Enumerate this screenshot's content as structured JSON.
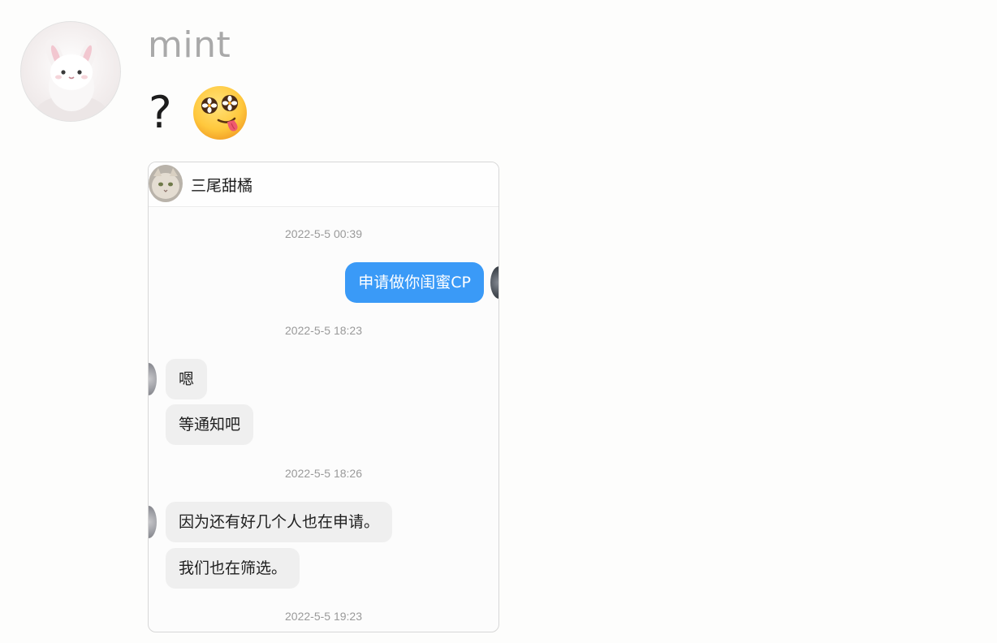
{
  "post": {
    "username": "mint",
    "message_text": "?",
    "emoji": "hot-face-with-flower-eyes-and-tongue"
  },
  "screenshot": {
    "contact_name": "三尾甜橘",
    "messages": [
      {
        "type": "timestamp",
        "text": "2022-5-5 00:39"
      },
      {
        "type": "outgoing",
        "text": "申请做你闺蜜CP"
      },
      {
        "type": "timestamp",
        "text": "2022-5-5 18:23"
      },
      {
        "type": "incoming",
        "text": "嗯"
      },
      {
        "type": "incoming",
        "text": "等通知吧"
      },
      {
        "type": "timestamp",
        "text": "2022-5-5 18:26"
      },
      {
        "type": "incoming",
        "text": "因为还有好几个人也在申请。"
      },
      {
        "type": "incoming",
        "text": "我们也在筛选。"
      },
      {
        "type": "timestamp",
        "text": "2022-5-5 19:23"
      }
    ]
  },
  "colors": {
    "outgoing_bubble": "#3a9af7",
    "incoming_bubble": "#efefef",
    "username": "#a9a9a9",
    "timestamp": "#9a9a9a"
  }
}
